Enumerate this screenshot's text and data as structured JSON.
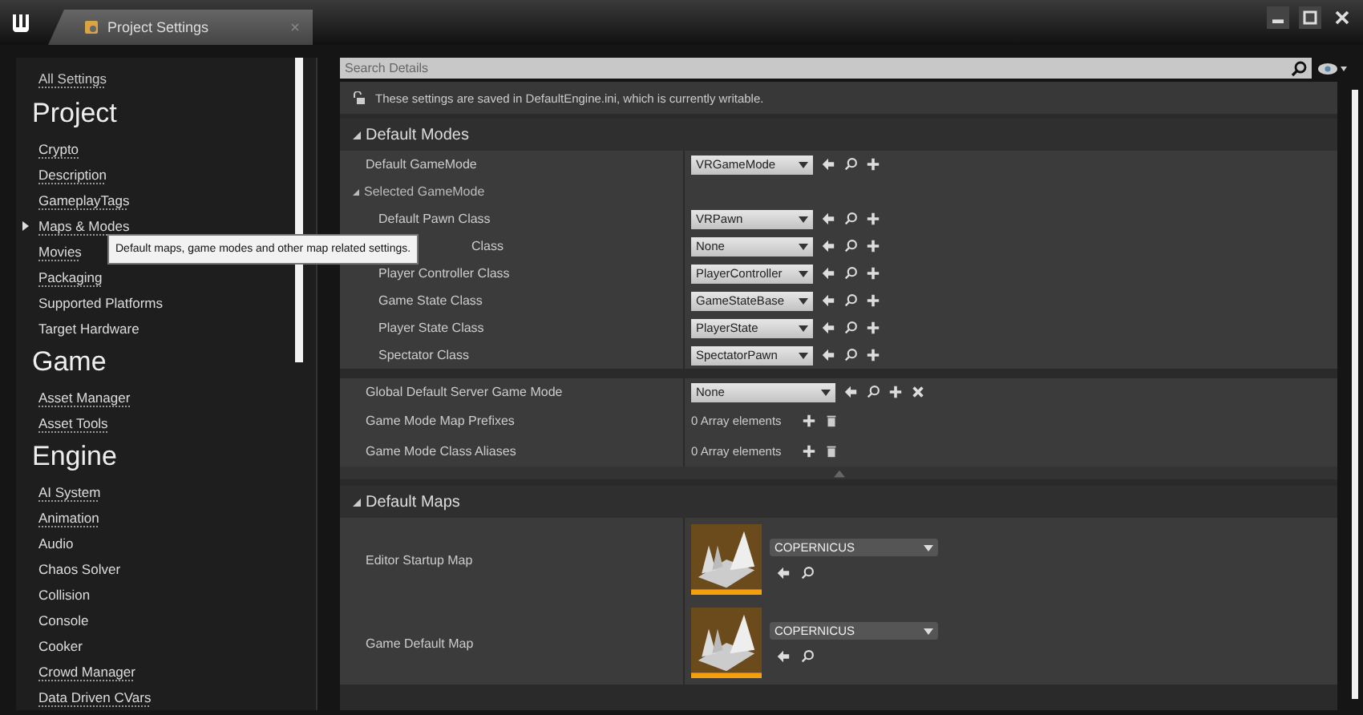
{
  "window": {
    "tab_title": "Project Settings"
  },
  "sidebar": {
    "all_settings": "All Settings",
    "groups": [
      {
        "title": "Project",
        "items": [
          {
            "label": "Crypto",
            "link": true,
            "selected": false
          },
          {
            "label": "Description",
            "link": true,
            "selected": false
          },
          {
            "label": "GameplayTags",
            "link": true,
            "selected": false
          },
          {
            "label": "Maps & Modes",
            "link": true,
            "selected": true
          },
          {
            "label": "Movies",
            "link": true,
            "selected": false
          },
          {
            "label": "Packaging",
            "link": true,
            "selected": false
          },
          {
            "label": "Supported Platforms",
            "link": false,
            "selected": false
          },
          {
            "label": "Target Hardware",
            "link": false,
            "selected": false
          }
        ]
      },
      {
        "title": "Game",
        "items": [
          {
            "label": "Asset Manager",
            "link": true,
            "selected": false
          },
          {
            "label": "Asset Tools",
            "link": true,
            "selected": false
          }
        ]
      },
      {
        "title": "Engine",
        "items": [
          {
            "label": "AI System",
            "link": true,
            "selected": false
          },
          {
            "label": "Animation",
            "link": true,
            "selected": false
          },
          {
            "label": "Audio",
            "link": false,
            "selected": false
          },
          {
            "label": "Chaos Solver",
            "link": false,
            "selected": false
          },
          {
            "label": "Collision",
            "link": false,
            "selected": false
          },
          {
            "label": "Console",
            "link": false,
            "selected": false
          },
          {
            "label": "Cooker",
            "link": false,
            "selected": false
          },
          {
            "label": "Crowd Manager",
            "link": true,
            "selected": false
          },
          {
            "label": "Data Driven CVars",
            "link": true,
            "selected": false
          }
        ]
      }
    ]
  },
  "tooltip": "Default maps, game modes and other map related settings.",
  "search": {
    "placeholder": "Search Details"
  },
  "info": "These settings are saved in DefaultEngine.ini, which is currently writable.",
  "sections": [
    {
      "title": "Default Modes",
      "expanded": true,
      "rows": [
        {
          "kind": "class",
          "label": "Default GameMode",
          "value": "VRGameMode",
          "nested": false
        },
        {
          "kind": "group",
          "label": "Selected GameMode",
          "expanded": true
        },
        {
          "kind": "class",
          "label": "Default Pawn Class",
          "value": "VRPawn",
          "nested": true
        },
        {
          "kind": "class",
          "label": "Class",
          "value": "None",
          "nested": true,
          "covered": true
        },
        {
          "kind": "class",
          "label": "Player Controller Class",
          "value": "PlayerController",
          "nested": true
        },
        {
          "kind": "class",
          "label": "Game State Class",
          "value": "GameStateBase",
          "nested": true
        },
        {
          "kind": "class",
          "label": "Player State Class",
          "value": "PlayerState",
          "nested": true
        },
        {
          "kind": "class",
          "label": "Spectator Class",
          "value": "SpectatorPawn",
          "nested": true
        },
        {
          "kind": "break"
        },
        {
          "kind": "server",
          "label": "Global Default Server Game Mode",
          "value": "None",
          "nested": false
        },
        {
          "kind": "array",
          "label": "Game Mode Map Prefixes",
          "value": "0 Array elements"
        },
        {
          "kind": "array",
          "label": "Game Mode Class Aliases",
          "value": "0 Array elements"
        }
      ]
    },
    {
      "title": "Default Maps",
      "expanded": true,
      "rows": [
        {
          "kind": "map",
          "label": "Editor Startup Map",
          "value": "COPERNICUS"
        },
        {
          "kind": "map",
          "label": "Game Default Map",
          "value": "COPERNICUS"
        }
      ]
    }
  ]
}
